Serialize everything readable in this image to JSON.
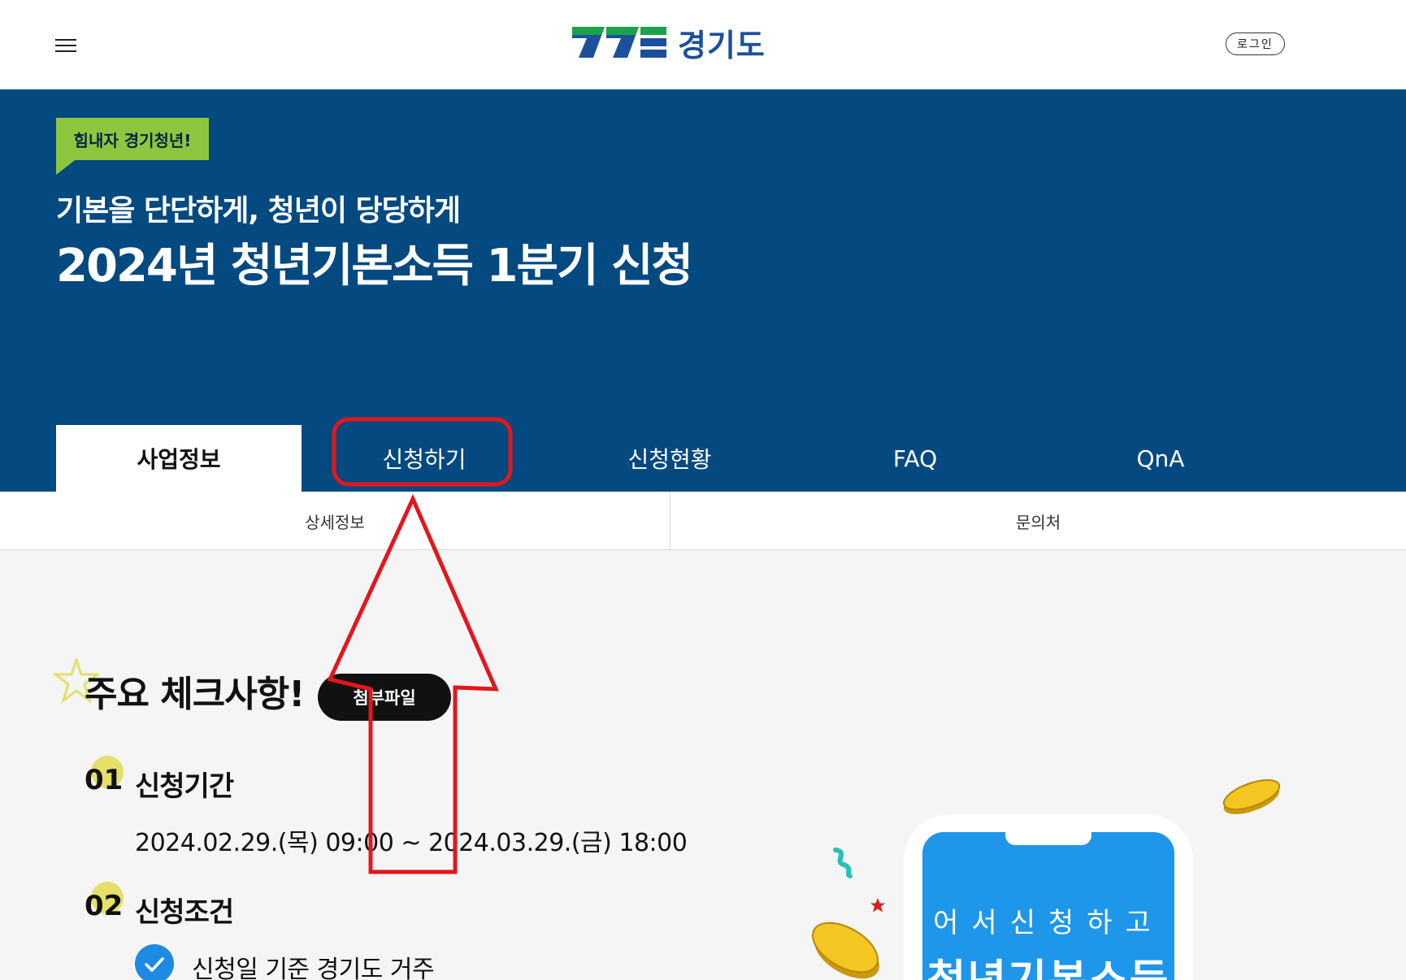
{
  "header": {
    "logo_text": "경기도",
    "login_label": "로그인"
  },
  "hero": {
    "badge": "힘내자 경기청년!",
    "subtitle": "기본을 단단하게, 청년이 당당하게",
    "title": "2024년 청년기본소득 1분기 신청"
  },
  "tabs": [
    {
      "label": "사업정보",
      "active": true
    },
    {
      "label": "신청하기",
      "active": false
    },
    {
      "label": "신청현황",
      "active": false
    },
    {
      "label": "FAQ",
      "active": false
    },
    {
      "label": "QnA",
      "active": false
    }
  ],
  "subtabs": [
    {
      "label": "상세정보"
    },
    {
      "label": "문의처"
    }
  ],
  "content": {
    "section_title": "주요 체크사항!",
    "attach_label": "첨부파일",
    "items": [
      {
        "num": "01",
        "title": "신청기간",
        "text": "2024.02.29.(목) 09:00 ~ 2024.03.29.(금) 18:00"
      },
      {
        "num": "02",
        "title": "신청조건",
        "check_text": "신청일 기준 경기도 거주"
      }
    ]
  },
  "illustration": {
    "phone_line1": "어서신청하고",
    "phone_line2": "청년기본소득"
  },
  "colors": {
    "hero_bg": "#04497f",
    "badge_green": "#8cc63f",
    "check_blue": "#1d8ae3",
    "annotation_red": "#e3161d"
  }
}
